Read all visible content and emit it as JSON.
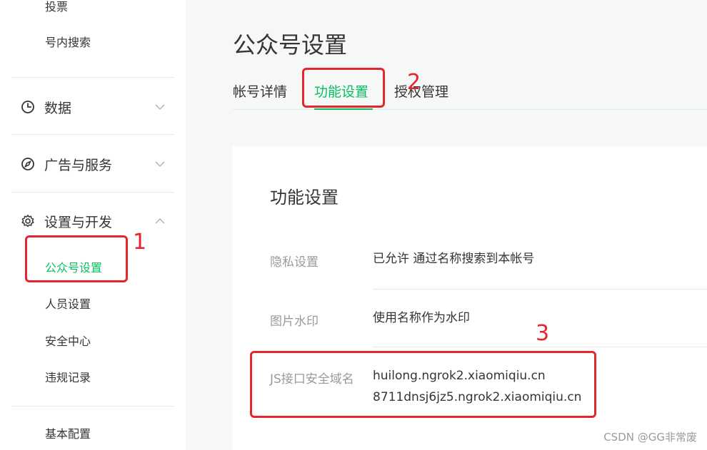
{
  "sidebar": {
    "items_top": [
      "投票",
      "号内搜索"
    ],
    "groups": [
      {
        "label": "数据",
        "icon": "clock-icon",
        "expanded": false
      },
      {
        "label": "广告与服务",
        "icon": "compass-icon",
        "expanded": false
      },
      {
        "label": "设置与开发",
        "icon": "gear-icon",
        "expanded": true
      }
    ],
    "settings_items": [
      "公众号设置",
      "人员设置",
      "安全中心",
      "违规记录"
    ],
    "bottom_item": "基本配置"
  },
  "main": {
    "title": "公众号设置",
    "tabs": [
      {
        "label": "帐号详情"
      },
      {
        "label": "功能设置",
        "active": true
      },
      {
        "label": "授权管理"
      }
    ],
    "panel": {
      "title": "功能设置",
      "rows": [
        {
          "label": "隐私设置",
          "value": "已允许 通过名称搜索到本帐号"
        },
        {
          "label": "图片水印",
          "value": "使用名称作为水印"
        },
        {
          "label": "JS接口安全域名",
          "values": [
            "huilong.ngrok2.xiaomiqiu.cn",
            "8711dnsj6jz5.ngrok2.xiaomiqiu.cn"
          ]
        }
      ]
    }
  },
  "annotations": [
    "1",
    "2",
    "3"
  ],
  "watermark": "CSDN @GG非常废",
  "colors": {
    "accent": "#07c160",
    "annotation": "#e4262c"
  }
}
